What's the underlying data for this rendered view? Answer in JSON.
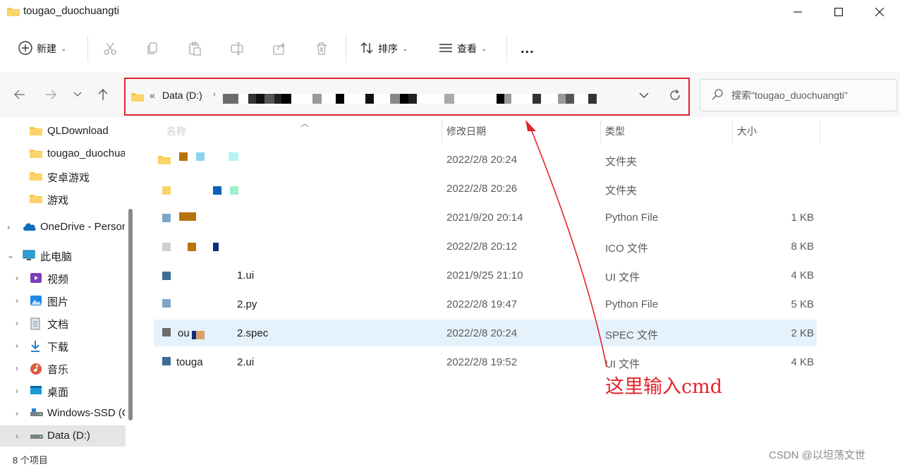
{
  "window": {
    "title": "tougao_duochuangti"
  },
  "toolbar": {
    "new_label": "新建",
    "sort_label": "排序",
    "view_label": "查看",
    "more_label": "..."
  },
  "address": {
    "drive": "Data (D:)"
  },
  "search": {
    "placeholder": "搜索\"tougao_duochuangti\""
  },
  "sidebar": {
    "items": [
      {
        "label": "QLDownload",
        "icon": "folder-icon"
      },
      {
        "label": "tougao_duochuangti",
        "icon": "folder-icon"
      },
      {
        "label": "安卓游戏",
        "icon": "folder-icon"
      },
      {
        "label": "游戏",
        "icon": "folder-icon"
      },
      {
        "label": "OneDrive - Personal",
        "icon": "cloud-icon"
      },
      {
        "label": "此电脑",
        "icon": "pc-icon"
      },
      {
        "label": "视频",
        "icon": "video-icon"
      },
      {
        "label": "图片",
        "icon": "picture-icon"
      },
      {
        "label": "文档",
        "icon": "document-icon"
      },
      {
        "label": "下载",
        "icon": "download-icon"
      },
      {
        "label": "音乐",
        "icon": "music-icon"
      },
      {
        "label": "桌面",
        "icon": "desktop-icon"
      },
      {
        "label": "Windows-SSD (C:)",
        "icon": "drive-icon"
      },
      {
        "label": "Data (D:)",
        "icon": "drive-icon"
      }
    ]
  },
  "status": {
    "count": "8 个项目"
  },
  "columns": {
    "name": "名称",
    "modified": "修改日期",
    "type": "类型",
    "size": "大小"
  },
  "files": [
    {
      "name": "",
      "modified": "2022/2/8 20:24",
      "type": "文件夹",
      "size": ""
    },
    {
      "name": "",
      "modified": "2022/2/8 20:26",
      "type": "文件夹",
      "size": ""
    },
    {
      "name": "",
      "modified": "2021/9/20 20:14",
      "type": "Python File",
      "size": "1 KB"
    },
    {
      "name": "",
      "modified": "2022/2/8 20:12",
      "type": "ICO 文件",
      "size": "8 KB"
    },
    {
      "name": "1.ui",
      "modified": "2021/9/25 21:10",
      "type": "UI 文件",
      "size": "4 KB"
    },
    {
      "name": "2.py",
      "modified": "2022/2/8 19:47",
      "type": "Python File",
      "size": "5 KB"
    },
    {
      "name": "2.spec",
      "modified": "2022/2/8 20:24",
      "type": "SPEC 文件",
      "size": "2 KB"
    },
    {
      "name": "2.ui",
      "modified": "2022/2/8 19:52",
      "type": "UI 文件",
      "size": "4 KB"
    }
  ],
  "annotation": {
    "text": "这里输入cmd"
  },
  "watermark": {
    "text": "CSDN @以坦荡文世"
  },
  "colors": {
    "annotation_red": "#e2252b",
    "selection_blue": "#e5f1fb",
    "folder_yellow": "#f8c74a"
  }
}
